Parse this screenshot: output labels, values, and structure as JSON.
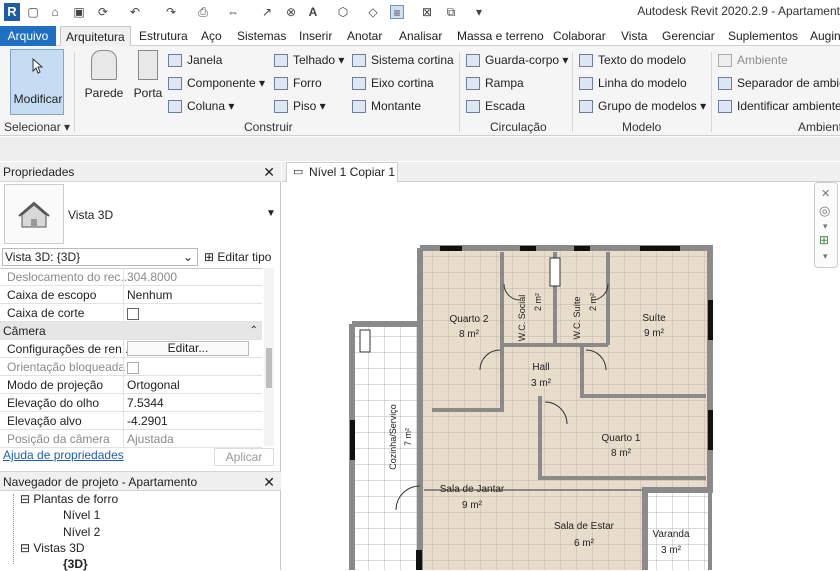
{
  "qat": {
    "app_icon": "revit-logo",
    "title": "Autodesk Revit 2020.2.9 - Apartament"
  },
  "tabs": [
    {
      "label": "Arquivo"
    },
    {
      "label": "Arquitetura"
    },
    {
      "label": "Estrutura"
    },
    {
      "label": "Aço"
    },
    {
      "label": "Sistemas"
    },
    {
      "label": "Inserir"
    },
    {
      "label": "Anotar"
    },
    {
      "label": "Analisar"
    },
    {
      "label": "Massa e terreno"
    },
    {
      "label": "Colaborar"
    },
    {
      "label": "Vista"
    },
    {
      "label": "Gerenciar"
    },
    {
      "label": "Suplementos"
    },
    {
      "label": "Augin"
    }
  ],
  "ribbon": {
    "modify": "Modificar",
    "wall": "Parede",
    "door": "Porta",
    "window": "Janela",
    "component": "Componente",
    "column": "Coluna",
    "roof": "Telhado",
    "ceiling": "Forro",
    "floor": "Piso",
    "curtain_system": "Sistema cortina",
    "curtain_grid": "Eixo cortina",
    "mullion": "Montante",
    "railing": "Guarda-corpo",
    "ramp": "Rampa",
    "stair": "Escada",
    "model_text": "Texto do modelo",
    "model_line": "Linha do modelo",
    "model_group": "Grupo de modelos",
    "room": "Ambiente",
    "room_separator": "Separador de ambie",
    "tag_room": "Identificar ambiente",
    "panels": {
      "select": "Selecionar",
      "build": "Construir",
      "circulation": "Circulação",
      "model": "Modelo",
      "room": "Ambient"
    }
  },
  "properties": {
    "title": "Propriedades",
    "type_name": "Vista 3D",
    "selector": "Vista 3D: {3D}",
    "edit_type": "Editar tipo",
    "rows": [
      {
        "k": "Deslocamento do rec...",
        "v": "304.8000",
        "dim": true
      },
      {
        "k": "Caixa de escopo",
        "v": "Nenhum"
      },
      {
        "k": "Caixa de corte",
        "v": ""
      }
    ],
    "camera_header": "Câmera",
    "camera_rows": [
      {
        "k": "Configurações de ren...",
        "v": "Editar..."
      },
      {
        "k": "Orientação bloqueada",
        "v": "",
        "dim": true
      },
      {
        "k": "Modo de projeção",
        "v": "Ortogonal"
      },
      {
        "k": "Elevação do olho",
        "v": "7.5344"
      },
      {
        "k": "Elevação alvo",
        "v": "-4.2901"
      },
      {
        "k": "Posição da câmera",
        "v": "Ajustada",
        "dim": true
      }
    ],
    "help_link": "Ajuda de propriedades",
    "apply": "Aplicar"
  },
  "browser": {
    "title": "Navegador de projeto - Apartamento",
    "items": [
      {
        "label": "Plantas de forro",
        "level": 1,
        "toggle": "⊟"
      },
      {
        "label": "Nível 1",
        "level": 2,
        "toggle": ""
      },
      {
        "label": "Nível 2",
        "level": 2,
        "toggle": ""
      },
      {
        "label": "Vistas 3D",
        "level": 1,
        "toggle": "⊟"
      },
      {
        "label": "{3D}",
        "level": 2,
        "toggle": "",
        "bold": true
      }
    ]
  },
  "view_tab": {
    "label": "Nível 1 Copiar 1"
  },
  "plan": {
    "rooms": [
      {
        "name": "Quarto 2",
        "area": "8 m²"
      },
      {
        "name": "W.C. Social",
        "area": "2 m²"
      },
      {
        "name": "W.C. Suíte",
        "area": "2 m²"
      },
      {
        "name": "Suíte",
        "area": "9 m²"
      },
      {
        "name": "Hall",
        "area": "3 m²"
      },
      {
        "name": "Quarto 1",
        "area": "8 m²"
      },
      {
        "name": "Cozinha/Serviço",
        "area": "7 m²"
      },
      {
        "name": "Sala de Jantar",
        "area": "9 m²"
      },
      {
        "name": "Sala de Estar",
        "area": "6 m²"
      },
      {
        "name": "Varanda",
        "area": "3 m²"
      }
    ],
    "colors": {
      "room_fill": "#e8dccb",
      "kitchen_fill": "#ffffff",
      "wall": "#8a8a8a",
      "grid": "#b5aa9b"
    }
  }
}
